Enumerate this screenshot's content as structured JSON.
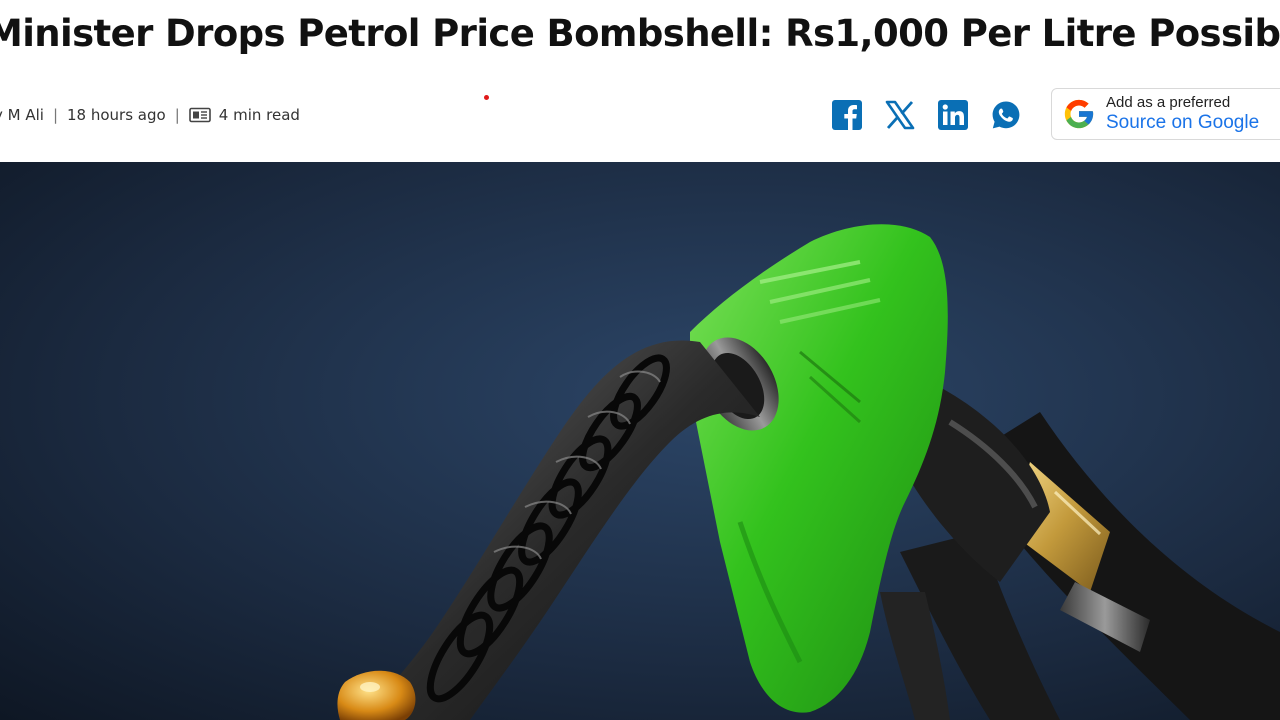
{
  "article": {
    "headline": "Minister Drops Petrol Price Bombshell: Rs1,000 Per Litre Possib",
    "author": "y M Ali",
    "separator": "|",
    "published": "18 hours ago",
    "read_time": "4 min read"
  },
  "share": {
    "icons": [
      "facebook-icon",
      "x-icon",
      "linkedin-icon",
      "whatsapp-icon"
    ],
    "color": "#0a6fb5"
  },
  "google_preferred": {
    "line1": "Add as a preferred",
    "line2": "Source on Google"
  },
  "colors": {
    "nozzle_green": "#33c21d",
    "background_navy": "#1b2a40"
  }
}
